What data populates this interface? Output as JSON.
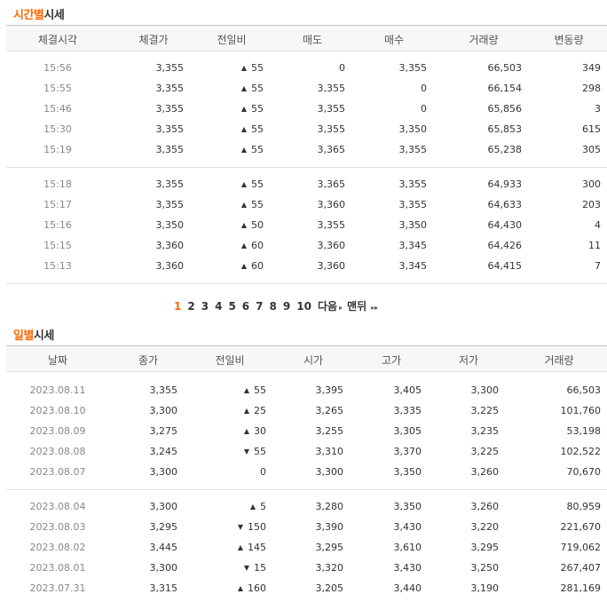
{
  "time_section": {
    "title_hl": "시간별",
    "title_rest": "시세",
    "headers": [
      "체결시각",
      "체결가",
      "전일비",
      "매도",
      "매수",
      "거래량",
      "변동량"
    ],
    "groups": [
      [
        {
          "time": "15:56",
          "price": "3,355",
          "dir": "up",
          "diff": "55",
          "ask": "0",
          "bid": "3,355",
          "volume": "66,503",
          "change": "349"
        },
        {
          "time": "15:55",
          "price": "3,355",
          "dir": "up",
          "diff": "55",
          "ask": "3,355",
          "bid": "0",
          "volume": "66,154",
          "change": "298"
        },
        {
          "time": "15:46",
          "price": "3,355",
          "dir": "up",
          "diff": "55",
          "ask": "3,355",
          "bid": "0",
          "volume": "65,856",
          "change": "3"
        },
        {
          "time": "15:30",
          "price": "3,355",
          "dir": "up",
          "diff": "55",
          "ask": "3,355",
          "bid": "3,350",
          "volume": "65,853",
          "change": "615"
        },
        {
          "time": "15:19",
          "price": "3,355",
          "dir": "up",
          "diff": "55",
          "ask": "3,365",
          "bid": "3,355",
          "volume": "65,238",
          "change": "305"
        }
      ],
      [
        {
          "time": "15:18",
          "price": "3,355",
          "dir": "up",
          "diff": "55",
          "ask": "3,365",
          "bid": "3,355",
          "volume": "64,933",
          "change": "300"
        },
        {
          "time": "15:17",
          "price": "3,355",
          "dir": "up",
          "diff": "55",
          "ask": "3,360",
          "bid": "3,355",
          "volume": "64,633",
          "change": "203"
        },
        {
          "time": "15:16",
          "price": "3,350",
          "dir": "up",
          "diff": "50",
          "ask": "3,355",
          "bid": "3,350",
          "volume": "64,430",
          "change": "4"
        },
        {
          "time": "15:15",
          "price": "3,360",
          "dir": "up",
          "diff": "60",
          "ask": "3,360",
          "bid": "3,345",
          "volume": "64,426",
          "change": "11"
        },
        {
          "time": "15:13",
          "price": "3,360",
          "dir": "up",
          "diff": "60",
          "ask": "3,360",
          "bid": "3,345",
          "volume": "64,415",
          "change": "7"
        }
      ]
    ]
  },
  "pagination": {
    "pages": [
      "1",
      "2",
      "3",
      "4",
      "5",
      "6",
      "7",
      "8",
      "9",
      "10"
    ],
    "current": "1",
    "next_label": "다음",
    "last_label": "맨뒤",
    "next_icon": "▸",
    "last_icon": "▸▸"
  },
  "daily_section": {
    "title_hl": "일별",
    "title_rest": "시세",
    "headers": [
      "날짜",
      "종가",
      "전일비",
      "시가",
      "고가",
      "저가",
      "거래량"
    ],
    "groups": [
      [
        {
          "date": "2023.08.11",
          "close": "3,355",
          "dir": "up",
          "diff": "55",
          "open": "3,395",
          "high": "3,405",
          "low": "3,300",
          "volume": "66,503"
        },
        {
          "date": "2023.08.10",
          "close": "3,300",
          "dir": "up",
          "diff": "25",
          "open": "3,265",
          "high": "3,335",
          "low": "3,225",
          "volume": "101,760"
        },
        {
          "date": "2023.08.09",
          "close": "3,275",
          "dir": "up",
          "diff": "30",
          "open": "3,255",
          "high": "3,305",
          "low": "3,235",
          "volume": "53,198"
        },
        {
          "date": "2023.08.08",
          "close": "3,245",
          "dir": "down",
          "diff": "55",
          "open": "3,310",
          "high": "3,370",
          "low": "3,225",
          "volume": "102,522"
        },
        {
          "date": "2023.08.07",
          "close": "3,300",
          "dir": "none",
          "diff": "0",
          "open": "3,300",
          "high": "3,350",
          "low": "3,260",
          "volume": "70,670"
        }
      ],
      [
        {
          "date": "2023.08.04",
          "close": "3,300",
          "dir": "up",
          "diff": "5",
          "open": "3,280",
          "high": "3,350",
          "low": "3,260",
          "volume": "80,959"
        },
        {
          "date": "2023.08.03",
          "close": "3,295",
          "dir": "down",
          "diff": "150",
          "open": "3,390",
          "high": "3,430",
          "low": "3,220",
          "volume": "221,670"
        },
        {
          "date": "2023.08.02",
          "close": "3,445",
          "dir": "up",
          "diff": "145",
          "open": "3,295",
          "high": "3,610",
          "low": "3,295",
          "volume": "719,062"
        },
        {
          "date": "2023.08.01",
          "close": "3,300",
          "dir": "down",
          "diff": "15",
          "open": "3,320",
          "high": "3,430",
          "low": "3,250",
          "volume": "267,407"
        },
        {
          "date": "2023.07.31",
          "close": "3,315",
          "dir": "up",
          "diff": "160",
          "open": "3,205",
          "high": "3,440",
          "low": "3,190",
          "volume": "281,169"
        }
      ]
    ]
  },
  "colors": {
    "up": "#d1000a",
    "down": "#1569c7",
    "accent": "#ff6600"
  },
  "icons": {
    "up": "▲",
    "down": "▼"
  }
}
